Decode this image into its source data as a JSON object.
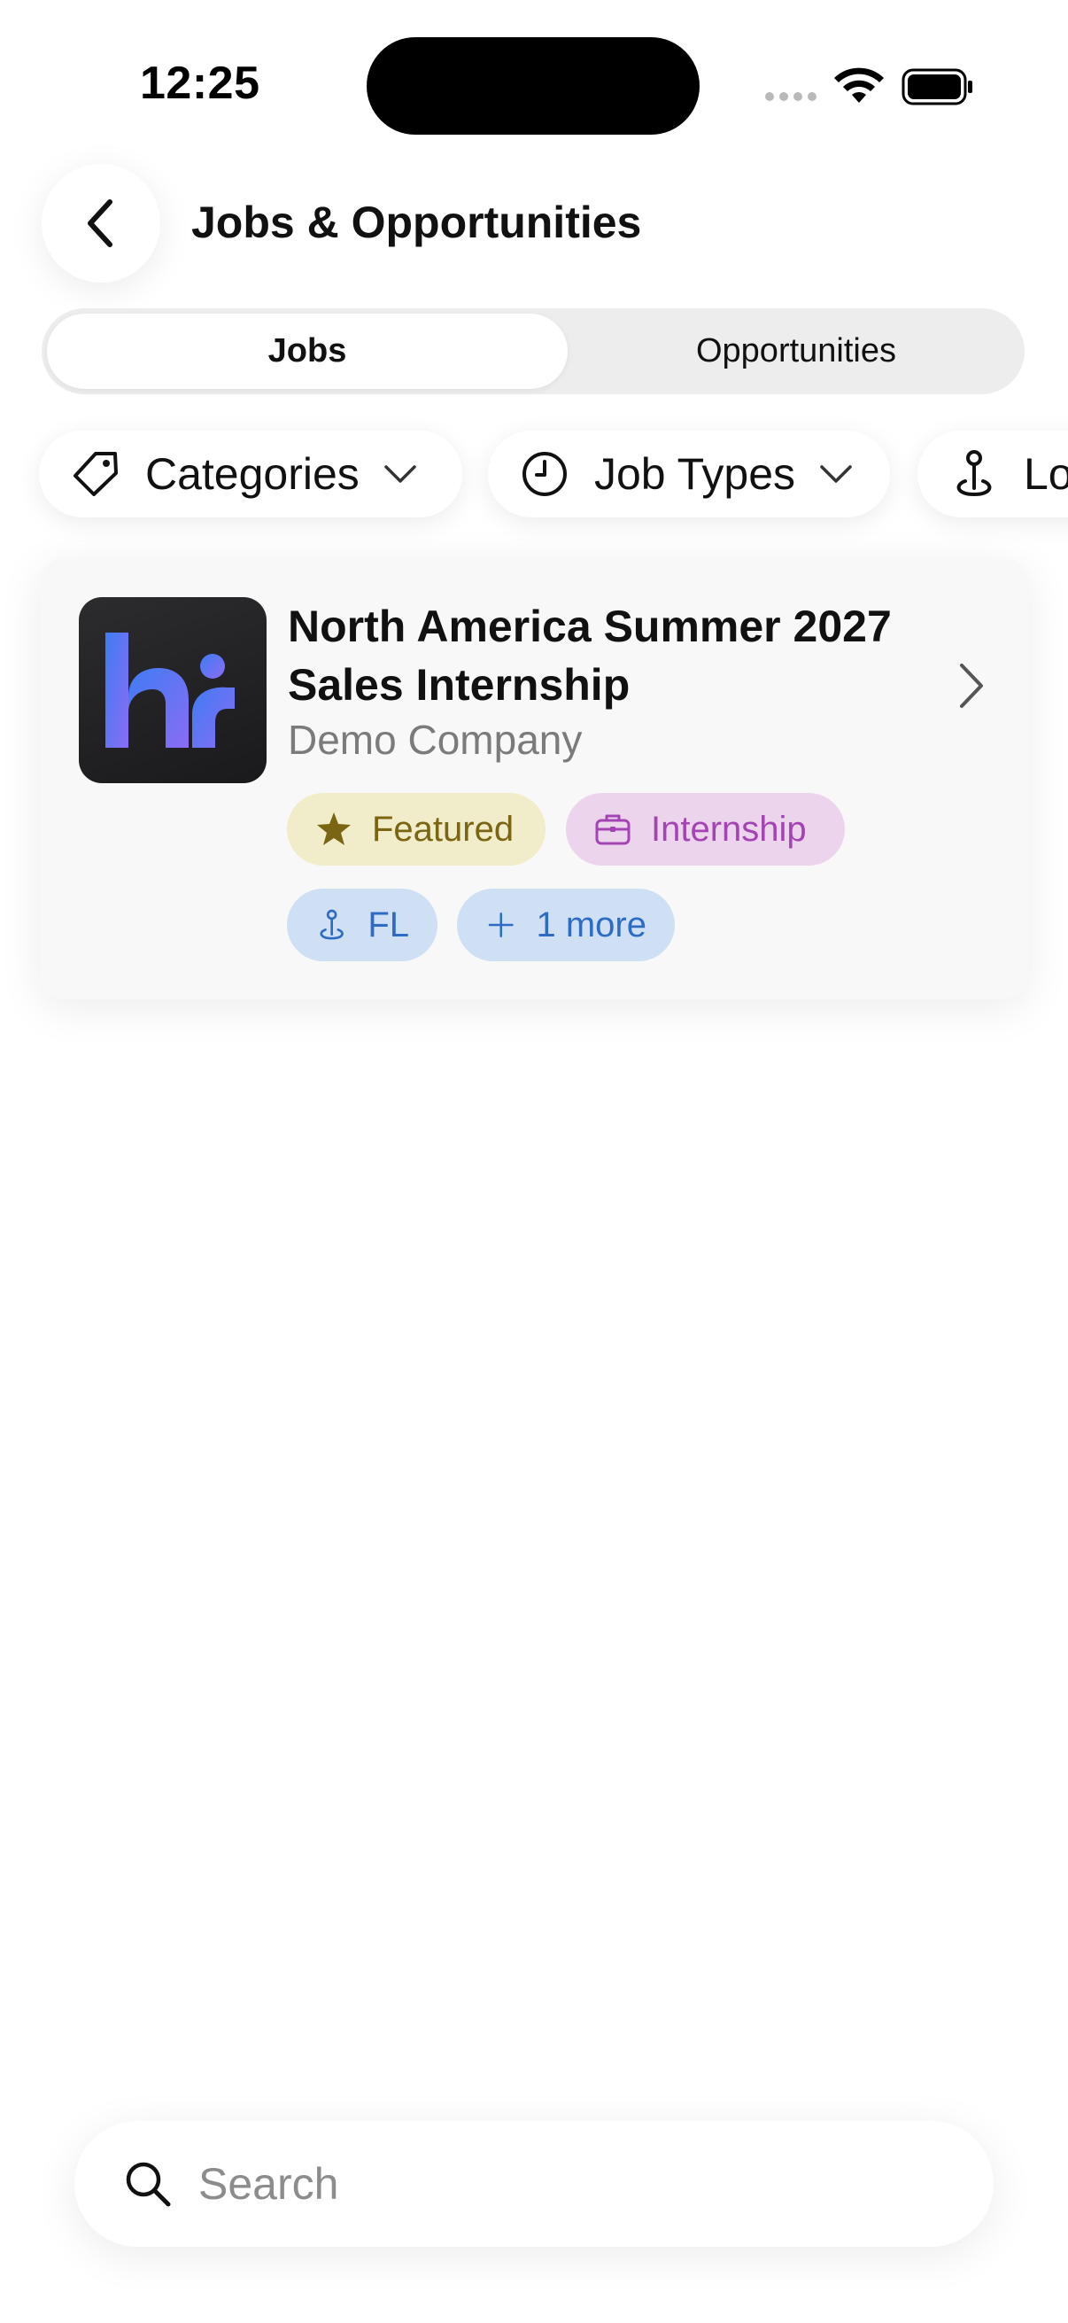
{
  "status_bar": {
    "time": "12:25"
  },
  "header": {
    "title": "Jobs & Opportunities",
    "back_icon": "chevron-left-icon"
  },
  "segments": {
    "jobs": "Jobs",
    "opportunities": "Opportunities",
    "selected": "Jobs"
  },
  "filters": {
    "categories": "Categories",
    "job_types": "Job Types",
    "location": "Location"
  },
  "job": {
    "title_line1": "North America Summer 2027",
    "title_line2": "Sales Internship",
    "company": "Demo Company",
    "tags": {
      "featured": "Featured",
      "internship": "Internship",
      "location": "FL",
      "more": "1 more"
    }
  },
  "search": {
    "placeholder": "Search"
  },
  "colors": {
    "featured_bg": "#f1ecc9",
    "featured_fg": "#7a6512",
    "internship_bg": "#ecd4ec",
    "internship_fg": "#a443b3",
    "location_bg": "#cfe0f4",
    "location_fg": "#2e6bc2"
  }
}
